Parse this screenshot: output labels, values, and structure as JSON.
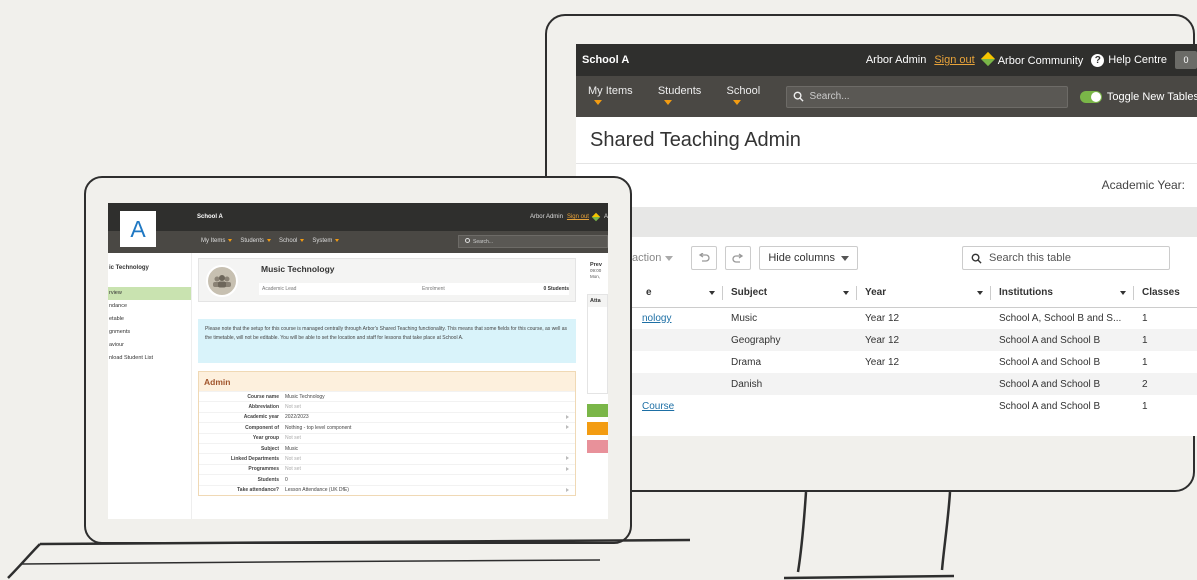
{
  "monitor": {
    "school": "School A",
    "user": "Arbor Admin",
    "sign_out": "Sign out",
    "community": "Arbor Community",
    "help": "Help Centre",
    "badge": "0",
    "nav": [
      "My Items",
      "Students",
      "School"
    ],
    "search_placeholder": "Search...",
    "toggle_label": "Toggle New Tables",
    "page_title": "Shared Teaching Admin",
    "academic_year_label": "Academic Year:",
    "action_label": "action",
    "hide_columns": "Hide columns",
    "table_search": "Search this table",
    "columns": [
      "e",
      "Subject",
      "Year",
      "Institutions",
      "Classes"
    ],
    "rows": [
      {
        "name": "nology",
        "subject": "Music",
        "year": "Year 12",
        "institutions": "School A, School B and S...",
        "classes": "1"
      },
      {
        "name": "",
        "subject": "Geography",
        "year": "Year 12",
        "institutions": "School A and School B",
        "classes": "1"
      },
      {
        "name": "",
        "subject": "Drama",
        "year": "Year 12",
        "institutions": "School A and School B",
        "classes": "1"
      },
      {
        "name": "",
        "subject": "Danish",
        "year": "",
        "institutions": "School A and School B",
        "classes": "2"
      },
      {
        "name": "Course",
        "subject": "",
        "year": "",
        "institutions": "School A and School B",
        "classes": "1"
      }
    ]
  },
  "laptop": {
    "logo": "A",
    "school": "School A",
    "user": "Arbor Admin",
    "sign_out": "Sign out",
    "community_trunc": "A",
    "nav": [
      "My Items",
      "Students",
      "School",
      "System"
    ],
    "search_placeholder": "Search...",
    "sidebar_title": "ic Technology",
    "sidebar": [
      "rview",
      "ndance",
      "etable",
      "gnments",
      "aviour",
      "nload Student List"
    ],
    "course_name": "Music Technology",
    "academic_lead_label": "Academic Lead",
    "enrolment_label": "Enrolment",
    "enrolment_value": "0 Students",
    "note": "Please note that the setup for this course is managed centrally through Arbor's Shared Teaching functionality. This means that some fields for this course, as well as the timetable, will not be editable. You will be able to set the location and staff for lessons that take place at School A.",
    "admin_title": "Admin",
    "admin_rows": [
      {
        "label": "Course name",
        "value": "Music Technology",
        "muted": false,
        "arrow": false
      },
      {
        "label": "Abbreviation",
        "value": "Not set",
        "muted": true,
        "arrow": false
      },
      {
        "label": "Academic year",
        "value": "2022/2023",
        "muted": false,
        "arrow": true
      },
      {
        "label": "Component of",
        "value": "Nothing - top level component",
        "muted": false,
        "arrow": true
      },
      {
        "label": "Year group",
        "value": "Not set",
        "muted": true,
        "arrow": false
      },
      {
        "label": "Subject",
        "value": "Music",
        "muted": false,
        "arrow": false
      },
      {
        "label": "Linked Departments",
        "value": "Not set",
        "muted": true,
        "arrow": true
      },
      {
        "label": "Programmes",
        "value": "Not set",
        "muted": true,
        "arrow": true
      },
      {
        "label": "Students",
        "value": "0",
        "muted": false,
        "arrow": false
      },
      {
        "label": "Take attendance?",
        "value": "Lesson Attendance (UK DfE)",
        "muted": false,
        "arrow": true
      }
    ],
    "right_title": "Prev",
    "right_sub1": "09:00",
    "right_sub2": "Mon,",
    "right_att": "Atta",
    "colors": {
      "green": "#7ab648",
      "orange": "#f39c12",
      "red": "#e8919a"
    }
  }
}
